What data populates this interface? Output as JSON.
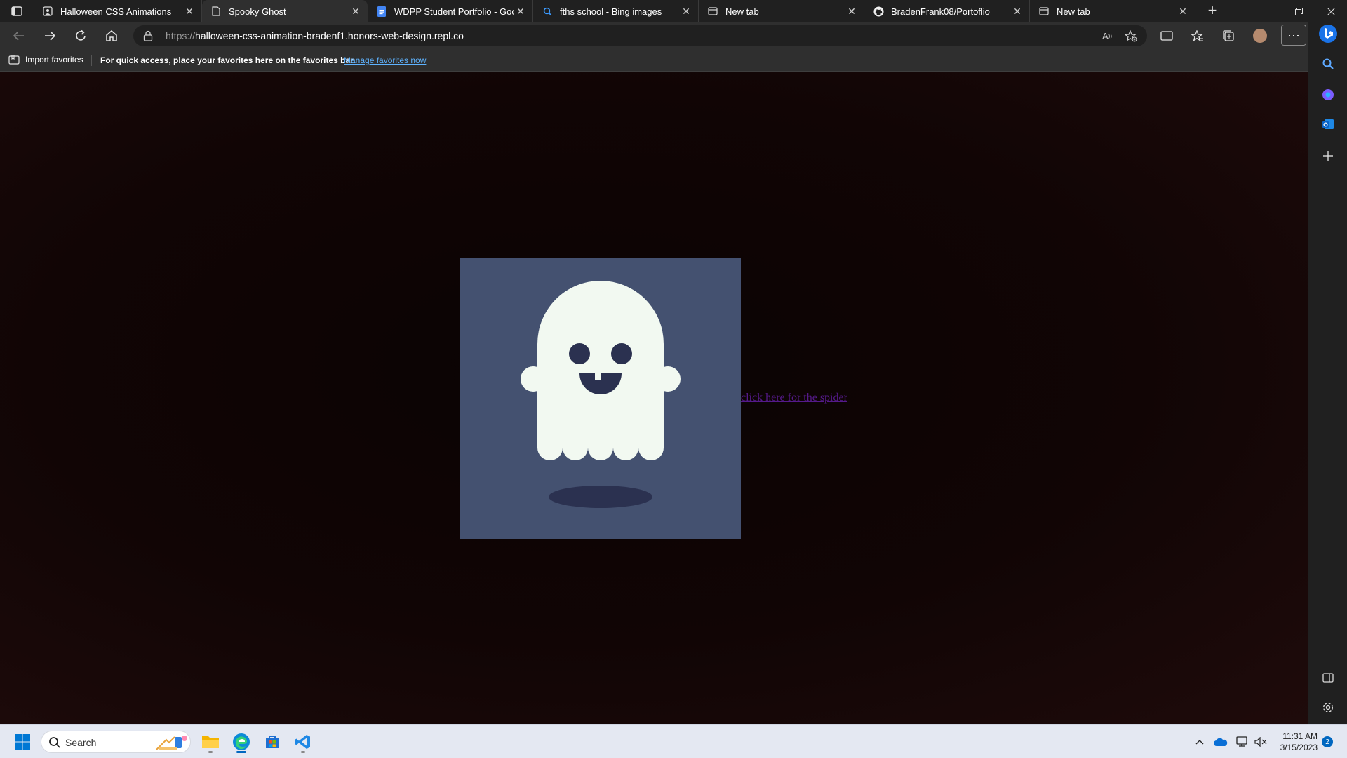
{
  "tabs": [
    {
      "title": "Halloween CSS Animations",
      "favicon": "repl-icon",
      "active": false
    },
    {
      "title": "Spooky Ghost",
      "favicon": "page-icon",
      "active": true
    },
    {
      "title": "WDPP Student Portfolio - Googl",
      "favicon": "docs-icon",
      "active": false
    },
    {
      "title": "fths school - Bing images",
      "favicon": "search-icon",
      "active": false
    },
    {
      "title": "New tab",
      "favicon": "newtab-icon",
      "active": false
    },
    {
      "title": "BradenFrank08/Portoflio",
      "favicon": "github-icon",
      "active": false
    },
    {
      "title": "New tab",
      "favicon": "newtab-icon",
      "active": false
    }
  ],
  "address": {
    "protocol": "https://",
    "host": "halloween-css-animation-bradenf1.honors-web-design.repl.co"
  },
  "favorites_bar": {
    "import_label": "Import favorites",
    "message": "For quick access, place your favorites here on the favorites bar.",
    "manage_link": "Manage favorites now"
  },
  "page": {
    "link_text": "click here for the spider",
    "colors": {
      "box": "#445170",
      "ghost": "#f2f9f1",
      "features": "#2b3150",
      "link": "#551a8b"
    }
  },
  "taskbar": {
    "search_label": "Search",
    "time": "11:31 AM",
    "date": "3/15/2023",
    "notifications": "2"
  }
}
